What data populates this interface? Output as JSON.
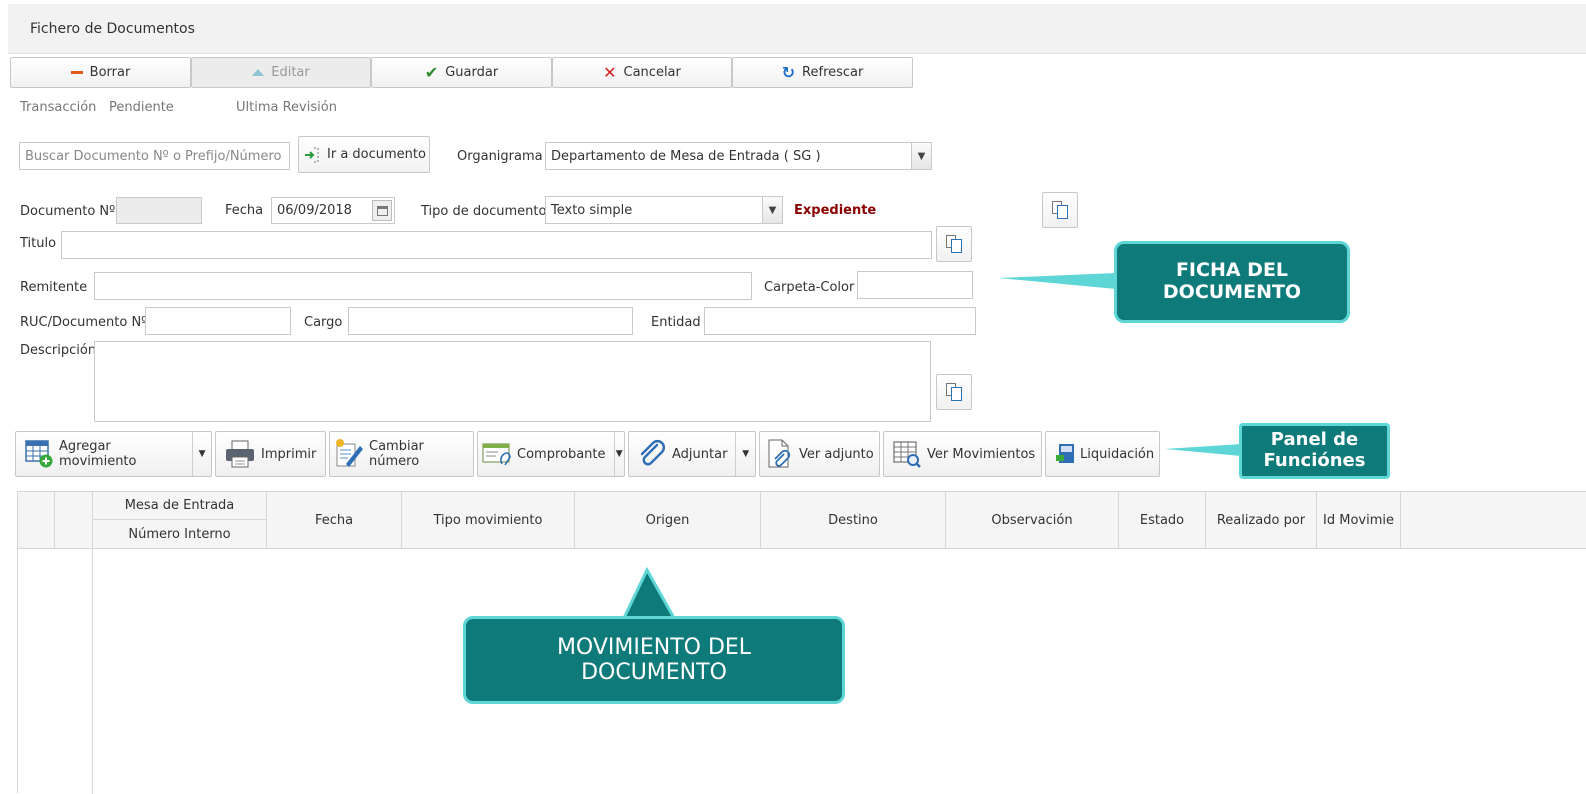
{
  "window": {
    "title": "Fichero de Documentos"
  },
  "toolbar": {
    "borrar": "Borrar",
    "editar": "Editar",
    "guardar": "Guardar",
    "cancelar": "Cancelar",
    "refrescar": "Refrescar"
  },
  "status": {
    "transaccion": "Transacción",
    "pendiente": "Pendiente",
    "ultima_revision": "Ultima Revisión"
  },
  "search": {
    "placeholder": "Buscar Documento Nº o Prefijo/Número",
    "go_button": "Ir a documento"
  },
  "organigrama": {
    "label": "Organigrama",
    "value": "Departamento de Mesa de Entrada ( SG )"
  },
  "form": {
    "documento_label": "Documento Nº",
    "documento_value": "",
    "fecha_label": "Fecha",
    "fecha_value": "06/09/2018",
    "tipo_label": "Tipo de documento",
    "tipo_value": "Texto simple",
    "expediente": "Expediente",
    "titulo_label": "Titulo",
    "remitente_label": "Remitente",
    "carpeta_label": "Carpeta-Color",
    "ruc_label": "RUC/Documento Nº",
    "cargo_label": "Cargo",
    "entidad_label": "Entidad",
    "descripcion_label": "Descripción"
  },
  "functions": {
    "agregar": "Agregar movimiento",
    "imprimir": "Imprimir",
    "cambiar": "Cambiar número",
    "comprobante": "Comprobante",
    "adjuntar": "Adjuntar",
    "ver_adjunto": "Ver adjunto",
    "ver_movimientos": "Ver Movimientos",
    "liquidacion": "Liquidación"
  },
  "grid": {
    "mesa_entrada": "Mesa de Entrada",
    "numero_interno": "Número Interno",
    "fecha": "Fecha",
    "tipo_movimiento": "Tipo movimiento",
    "origen": "Origen",
    "destino": "Destino",
    "observacion": "Observación",
    "estado": "Estado",
    "realizado_por": "Realizado por",
    "id_movimiento": "Id Movimie"
  },
  "callouts": {
    "ficha_1": "FICHA DEL",
    "ficha_2": "DOCUMENTO",
    "panel_1": "Panel de",
    "panel_2": "Funciónes",
    "movimiento_1": "MOVIMIENTO DEL",
    "movimiento_2": "DOCUMENTO"
  },
  "colors": {
    "callout_fill": "#0f7a7a",
    "callout_border": "#5fd6d6",
    "expediente": "#8b0000"
  }
}
